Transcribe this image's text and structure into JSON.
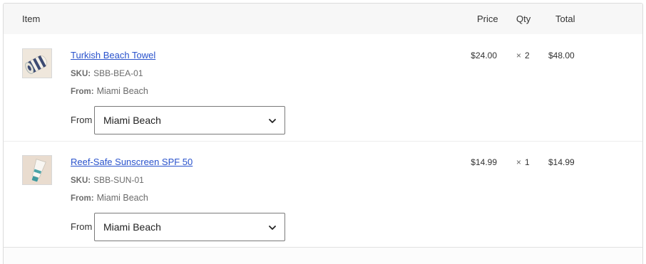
{
  "table": {
    "headers": {
      "item": "Item",
      "price": "Price",
      "qty": "Qty",
      "total": "Total"
    },
    "rows": [
      {
        "name": "Turkish Beach Towel",
        "sku_label": "SKU:",
        "sku": "SBB-BEA-01",
        "from_label": "From:",
        "from_value": "Miami Beach",
        "select_label": "From",
        "select_value": "Miami Beach",
        "price": "$24.00",
        "qty_mark": "×",
        "qty": "2",
        "total": "$48.00",
        "thumb_icon": "rolled-towel-icon"
      },
      {
        "name": "Reef-Safe Sunscreen SPF 50",
        "sku_label": "SKU:",
        "sku": "SBB-SUN-01",
        "from_label": "From:",
        "from_value": "Miami Beach",
        "select_label": "From",
        "select_value": "Miami Beach",
        "price": "$14.99",
        "qty_mark": "×",
        "qty": "1",
        "total": "$14.99",
        "thumb_icon": "sunscreen-tube-icon"
      }
    ]
  },
  "colors": {
    "link": "#2952cc",
    "header_bg": "#f7f7f7",
    "border": "#dcdcdc"
  }
}
